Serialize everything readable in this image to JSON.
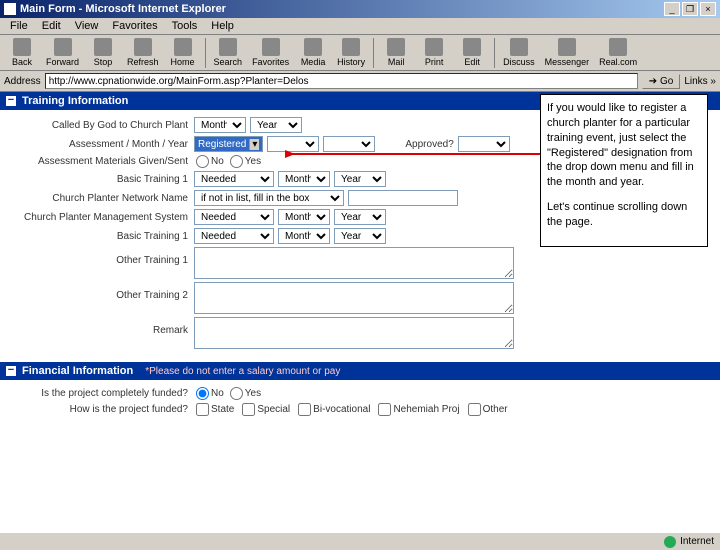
{
  "window": {
    "title": "Main Form - Microsoft Internet Explorer",
    "min": "_",
    "max": "❐",
    "close": "×"
  },
  "menu": {
    "file": "File",
    "edit": "Edit",
    "view": "View",
    "favorites": "Favorites",
    "tools": "Tools",
    "help": "Help"
  },
  "toolbar": {
    "back": "Back",
    "forward": "Forward",
    "stop": "Stop",
    "refresh": "Refresh",
    "home": "Home",
    "search": "Search",
    "favorites": "Favorites",
    "media": "Media",
    "history": "History",
    "mail": "Mail",
    "print": "Print",
    "edit": "Edit",
    "discuss": "Discuss",
    "messenger": "Messenger",
    "realcom": "Real.com"
  },
  "address": {
    "label": "Address",
    "value": "http://www.cpnationwide.org/MainForm.asp?Planter=Delos",
    "go": "Go",
    "links": "Links »"
  },
  "sections": {
    "training": "Training Information",
    "financial": "Financial Information"
  },
  "labels": {
    "called": "Called By God to Church Plant",
    "assessmentMY": "Assessment / Month / Year",
    "materials": "Assessment Materials Given/Sent",
    "basic1": "Basic Training 1",
    "network": "Church Planter Network Name",
    "mgmt": "Church Planter Management System",
    "basic1b": "Basic Training 1",
    "other1": "Other Training 1",
    "other2": "Other Training 2",
    "remark": "Remark",
    "funded": "Is the project completely funded?",
    "howfunded": "How is the project funded?"
  },
  "options": {
    "month": "Month",
    "year": "Year",
    "registered": "Registered",
    "approved": "Approved?",
    "no": "No",
    "yes": "Yes",
    "needed": "Needed",
    "notinlist": "if not in list, fill in the box",
    "state": "State",
    "special": "Special",
    "bivoc": "Bi-vocational",
    "nehemiah": "Nehemiah Proj",
    "other": "Other"
  },
  "finNote": "*Please do not enter a salary amount or pay",
  "callout": {
    "p1": "If you would like to register a church planter for a particular training event, just select the \"Registered\" designation from the drop down menu and fill in the month and year.",
    "p2": "Let's continue scrolling down the page."
  },
  "status": {
    "internet": "Internet"
  }
}
